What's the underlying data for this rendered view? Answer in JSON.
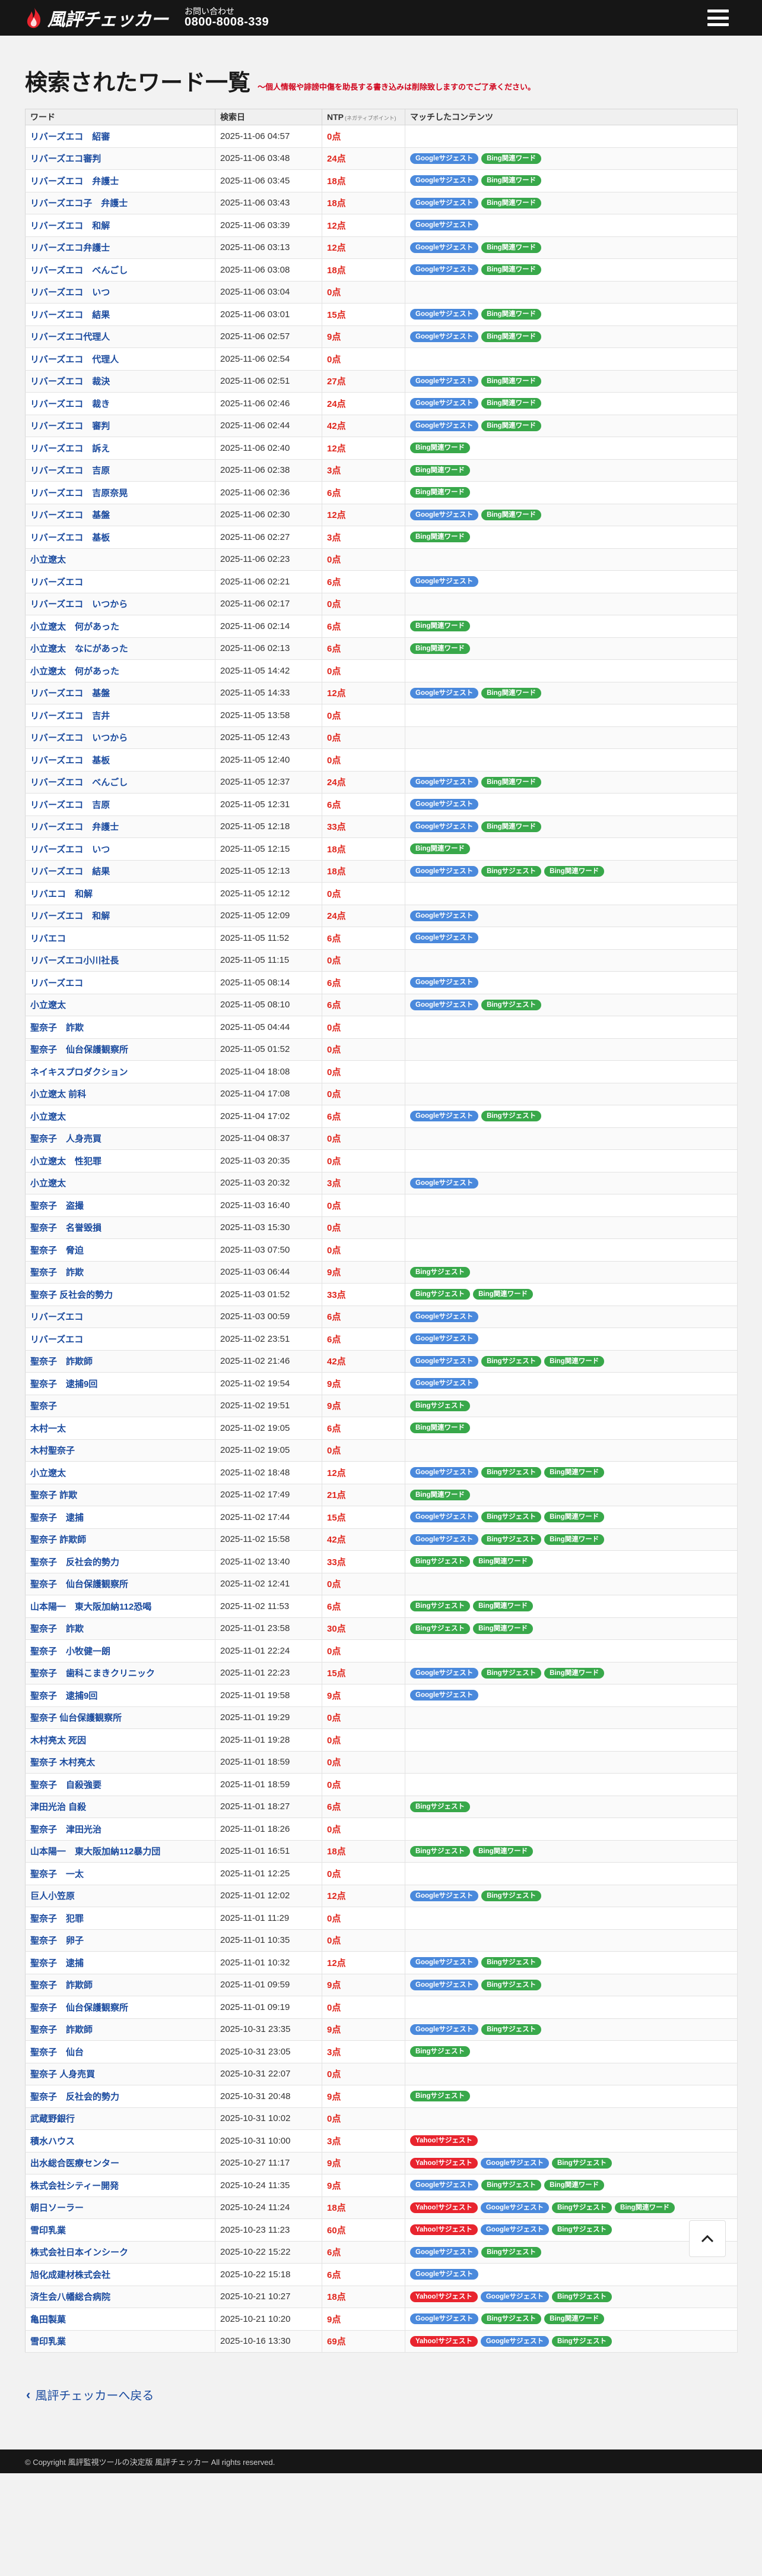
{
  "header": {
    "logo_text": "風評チェッカー",
    "contact_label": "お問い合わせ",
    "phone": "0800-8008-339"
  },
  "page": {
    "title": "検索されたワード一覧",
    "notice": "〜個人情報や誹謗中傷を助長する書き込みは削除致しますのでご了承ください。"
  },
  "table": {
    "headers": {
      "word": "ワード",
      "date": "検索日",
      "ntp": "NTP",
      "ntp_sub": "(ネガティブポイント)",
      "contents": "マッチしたコンテンツ"
    },
    "rows": [
      {
        "word": "リバーズエコ　紹審",
        "date": "2025-11-06 04:57",
        "points": "0点",
        "tags": []
      },
      {
        "word": "リバーズエコ審判",
        "date": "2025-11-06 03:48",
        "points": "24点",
        "tags": [
          "G",
          "BK"
        ]
      },
      {
        "word": "リバーズエコ　弁護士",
        "date": "2025-11-06 03:45",
        "points": "18点",
        "tags": [
          "G",
          "BK"
        ]
      },
      {
        "word": "リバーズエコ子　弁護士",
        "date": "2025-11-06 03:43",
        "points": "18点",
        "tags": [
          "G",
          "BK"
        ]
      },
      {
        "word": "リバーズエコ　和解",
        "date": "2025-11-06 03:39",
        "points": "12点",
        "tags": [
          "G"
        ]
      },
      {
        "word": "リバーズエコ弁護士",
        "date": "2025-11-06 03:13",
        "points": "12点",
        "tags": [
          "G",
          "BK"
        ]
      },
      {
        "word": "リバーズエコ　べんごし",
        "date": "2025-11-06 03:08",
        "points": "18点",
        "tags": [
          "G",
          "BK"
        ]
      },
      {
        "word": "リバーズエコ　いつ",
        "date": "2025-11-06 03:04",
        "points": "0点",
        "tags": []
      },
      {
        "word": "リバーズエコ　結果",
        "date": "2025-11-06 03:01",
        "points": "15点",
        "tags": [
          "G",
          "BK"
        ]
      },
      {
        "word": "リバーズエコ代理人",
        "date": "2025-11-06 02:57",
        "points": "9点",
        "tags": [
          "G",
          "BK"
        ]
      },
      {
        "word": "リバーズエコ　代理人",
        "date": "2025-11-06 02:54",
        "points": "0点",
        "tags": []
      },
      {
        "word": "リバーズエコ　裁決",
        "date": "2025-11-06 02:51",
        "points": "27点",
        "tags": [
          "G",
          "BK"
        ]
      },
      {
        "word": "リバーズエコ　裁き",
        "date": "2025-11-06 02:46",
        "points": "24点",
        "tags": [
          "G",
          "BK"
        ]
      },
      {
        "word": "リバーズエコ　審判",
        "date": "2025-11-06 02:44",
        "points": "42点",
        "tags": [
          "G",
          "BK"
        ]
      },
      {
        "word": "リバーズエコ　訴え",
        "date": "2025-11-06 02:40",
        "points": "12点",
        "tags": [
          "BK"
        ]
      },
      {
        "word": "リバーズエコ　吉原",
        "date": "2025-11-06 02:38",
        "points": "3点",
        "tags": [
          "BK"
        ]
      },
      {
        "word": "リバーズエコ　吉原奈晃",
        "date": "2025-11-06 02:36",
        "points": "6点",
        "tags": [
          "BK"
        ]
      },
      {
        "word": "リバーズエコ　基盤",
        "date": "2025-11-06 02:30",
        "points": "12点",
        "tags": [
          "G",
          "BK"
        ]
      },
      {
        "word": "リバーズエコ　基板",
        "date": "2025-11-06 02:27",
        "points": "3点",
        "tags": [
          "BK"
        ]
      },
      {
        "word": "小立遼太",
        "date": "2025-11-06 02:23",
        "points": "0点",
        "tags": []
      },
      {
        "word": "リバーズエコ",
        "date": "2025-11-06 02:21",
        "points": "6点",
        "tags": [
          "G"
        ]
      },
      {
        "word": "リバーズエコ　いつから",
        "date": "2025-11-06 02:17",
        "points": "0点",
        "tags": []
      },
      {
        "word": "小立遼太　何があった",
        "date": "2025-11-06 02:14",
        "points": "6点",
        "tags": [
          "BK"
        ]
      },
      {
        "word": "小立遼太　なにがあった",
        "date": "2025-11-06 02:13",
        "points": "6点",
        "tags": [
          "BK"
        ]
      },
      {
        "word": "小立遼太　何があった",
        "date": "2025-11-05 14:42",
        "points": "0点",
        "tags": []
      },
      {
        "word": "リバーズエコ　基盤",
        "date": "2025-11-05 14:33",
        "points": "12点",
        "tags": [
          "G",
          "BK"
        ]
      },
      {
        "word": "リバーズエコ　吉井",
        "date": "2025-11-05 13:58",
        "points": "0点",
        "tags": []
      },
      {
        "word": "リバーズエコ　いつから",
        "date": "2025-11-05 12:43",
        "points": "0点",
        "tags": []
      },
      {
        "word": "リバーズエコ　基板",
        "date": "2025-11-05 12:40",
        "points": "0点",
        "tags": []
      },
      {
        "word": "リバーズエコ　べんごし",
        "date": "2025-11-05 12:37",
        "points": "24点",
        "tags": [
          "G",
          "BK"
        ]
      },
      {
        "word": "リバーズエコ　吉原",
        "date": "2025-11-05 12:31",
        "points": "6点",
        "tags": [
          "G"
        ]
      },
      {
        "word": "リバーズエコ　弁護士",
        "date": "2025-11-05 12:18",
        "points": "33点",
        "tags": [
          "G",
          "BK"
        ]
      },
      {
        "word": "リバーズエコ　いつ",
        "date": "2025-11-05 12:15",
        "points": "18点",
        "tags": [
          "BK"
        ]
      },
      {
        "word": "リバーズエコ　結果",
        "date": "2025-11-05 12:13",
        "points": "18点",
        "tags": [
          "G",
          "BS",
          "BK"
        ]
      },
      {
        "word": "リバエコ　和解",
        "date": "2025-11-05 12:12",
        "points": "0点",
        "tags": []
      },
      {
        "word": "リバーズエコ　和解",
        "date": "2025-11-05 12:09",
        "points": "24点",
        "tags": [
          "G"
        ]
      },
      {
        "word": "リバエコ",
        "date": "2025-11-05 11:52",
        "points": "6点",
        "tags": [
          "G"
        ]
      },
      {
        "word": "リバーズエコ小川社長",
        "date": "2025-11-05 11:15",
        "points": "0点",
        "tags": []
      },
      {
        "word": "リバーズエコ",
        "date": "2025-11-05 08:14",
        "points": "6点",
        "tags": [
          "G"
        ]
      },
      {
        "word": "小立遼太",
        "date": "2025-11-05 08:10",
        "points": "6点",
        "tags": [
          "G",
          "BS"
        ]
      },
      {
        "word": "聖奈子　詐欺",
        "date": "2025-11-05 04:44",
        "points": "0点",
        "tags": []
      },
      {
        "word": "聖奈子　仙台保護観察所",
        "date": "2025-11-05 01:52",
        "points": "0点",
        "tags": []
      },
      {
        "word": "ネイキスプロダクション",
        "date": "2025-11-04 18:08",
        "points": "0点",
        "tags": []
      },
      {
        "word": "小立遼太 前科",
        "date": "2025-11-04 17:08",
        "points": "0点",
        "tags": []
      },
      {
        "word": "小立遼太",
        "date": "2025-11-04 17:02",
        "points": "6点",
        "tags": [
          "G",
          "BS"
        ]
      },
      {
        "word": "聖奈子　人身売買",
        "date": "2025-11-04 08:37",
        "points": "0点",
        "tags": []
      },
      {
        "word": "小立遼太　性犯罪",
        "date": "2025-11-03 20:35",
        "points": "0点",
        "tags": []
      },
      {
        "word": "小立遼太",
        "date": "2025-11-03 20:32",
        "points": "3点",
        "tags": [
          "G"
        ]
      },
      {
        "word": "聖奈子　盗撮",
        "date": "2025-11-03 16:40",
        "points": "0点",
        "tags": []
      },
      {
        "word": "聖奈子　名誉毀損",
        "date": "2025-11-03 15:30",
        "points": "0点",
        "tags": []
      },
      {
        "word": "聖奈子　脅迫",
        "date": "2025-11-03 07:50",
        "points": "0点",
        "tags": []
      },
      {
        "word": "聖奈子　詐欺",
        "date": "2025-11-03 06:44",
        "points": "9点",
        "tags": [
          "BS"
        ]
      },
      {
        "word": "聖奈子 反社会的勢力",
        "date": "2025-11-03 01:52",
        "points": "33点",
        "tags": [
          "BS",
          "BK"
        ]
      },
      {
        "word": "リバーズエコ",
        "date": "2025-11-03 00:59",
        "points": "6点",
        "tags": [
          "G"
        ]
      },
      {
        "word": "リバーズエコ",
        "date": "2025-11-02 23:51",
        "points": "6点",
        "tags": [
          "G"
        ]
      },
      {
        "word": "聖奈子　詐欺師",
        "date": "2025-11-02 21:46",
        "points": "42点",
        "tags": [
          "G",
          "BS",
          "BK"
        ]
      },
      {
        "word": "聖奈子　逮捕9回",
        "date": "2025-11-02 19:54",
        "points": "9点",
        "tags": [
          "G"
        ]
      },
      {
        "word": "聖奈子",
        "date": "2025-11-02 19:51",
        "points": "9点",
        "tags": [
          "BS"
        ]
      },
      {
        "word": "木村一太",
        "date": "2025-11-02 19:05",
        "points": "6点",
        "tags": [
          "BK"
        ]
      },
      {
        "word": "木村聖奈子",
        "date": "2025-11-02 19:05",
        "points": "0点",
        "tags": []
      },
      {
        "word": "小立遼太",
        "date": "2025-11-02 18:48",
        "points": "12点",
        "tags": [
          "G",
          "BS",
          "BK"
        ]
      },
      {
        "word": "聖奈子 詐欺",
        "date": "2025-11-02 17:49",
        "points": "21点",
        "tags": [
          "BK"
        ]
      },
      {
        "word": "聖奈子　逮捕",
        "date": "2025-11-02 17:44",
        "points": "15点",
        "tags": [
          "G",
          "BS",
          "BK"
        ]
      },
      {
        "word": "聖奈子 詐欺師",
        "date": "2025-11-02 15:58",
        "points": "42点",
        "tags": [
          "G",
          "BS",
          "BK"
        ]
      },
      {
        "word": "聖奈子　反社会的勢力",
        "date": "2025-11-02 13:40",
        "points": "33点",
        "tags": [
          "BS",
          "BK"
        ]
      },
      {
        "word": "聖奈子　仙台保護観察所",
        "date": "2025-11-02 12:41",
        "points": "0点",
        "tags": []
      },
      {
        "word": "山本陽一　東大阪加納112恐喝",
        "date": "2025-11-02 11:53",
        "points": "6点",
        "tags": [
          "BS",
          "BK"
        ]
      },
      {
        "word": "聖奈子　詐欺",
        "date": "2025-11-01 23:58",
        "points": "30点",
        "tags": [
          "BS",
          "BK"
        ]
      },
      {
        "word": "聖奈子　小牧健一朗",
        "date": "2025-11-01 22:24",
        "points": "0点",
        "tags": []
      },
      {
        "word": "聖奈子　歯科こまきクリニック",
        "date": "2025-11-01 22:23",
        "points": "15点",
        "tags": [
          "G",
          "BS",
          "BK"
        ]
      },
      {
        "word": "聖奈子　逮捕9回",
        "date": "2025-11-01 19:58",
        "points": "9点",
        "tags": [
          "G"
        ]
      },
      {
        "word": "聖奈子 仙台保護観察所",
        "date": "2025-11-01 19:29",
        "points": "0点",
        "tags": []
      },
      {
        "word": "木村亮太 死因",
        "date": "2025-11-01 19:28",
        "points": "0点",
        "tags": []
      },
      {
        "word": "聖奈子 木村亮太",
        "date": "2025-11-01 18:59",
        "points": "0点",
        "tags": []
      },
      {
        "word": "聖奈子　自殺強要",
        "date": "2025-11-01 18:59",
        "points": "0点",
        "tags": []
      },
      {
        "word": "津田光治 自殺",
        "date": "2025-11-01 18:27",
        "points": "6点",
        "tags": [
          "BS"
        ]
      },
      {
        "word": "聖奈子　津田光治",
        "date": "2025-11-01 18:26",
        "points": "0点",
        "tags": []
      },
      {
        "word": "山本陽一　東大阪加納112暴力団",
        "date": "2025-11-01 16:51",
        "points": "18点",
        "tags": [
          "BS",
          "BK"
        ]
      },
      {
        "word": "聖奈子　一太",
        "date": "2025-11-01 12:25",
        "points": "0点",
        "tags": []
      },
      {
        "word": "巨人小笠原",
        "date": "2025-11-01 12:02",
        "points": "12点",
        "tags": [
          "G",
          "BS"
        ]
      },
      {
        "word": "聖奈子　犯罪",
        "date": "2025-11-01 11:29",
        "points": "0点",
        "tags": []
      },
      {
        "word": "聖奈子　卵子",
        "date": "2025-11-01 10:35",
        "points": "0点",
        "tags": []
      },
      {
        "word": "聖奈子　逮捕",
        "date": "2025-11-01 10:32",
        "points": "12点",
        "tags": [
          "G",
          "BS"
        ]
      },
      {
        "word": "聖奈子　詐欺師",
        "date": "2025-11-01 09:59",
        "points": "9点",
        "tags": [
          "G",
          "BS"
        ]
      },
      {
        "word": "聖奈子　仙台保護観察所",
        "date": "2025-11-01 09:19",
        "points": "0点",
        "tags": []
      },
      {
        "word": "聖奈子　詐欺師",
        "date": "2025-10-31 23:35",
        "points": "9点",
        "tags": [
          "G",
          "BS"
        ]
      },
      {
        "word": "聖奈子　仙台",
        "date": "2025-10-31 23:05",
        "points": "3点",
        "tags": [
          "BS"
        ]
      },
      {
        "word": "聖奈子 人身売買",
        "date": "2025-10-31 22:07",
        "points": "0点",
        "tags": []
      },
      {
        "word": "聖奈子　反社会的勢力",
        "date": "2025-10-31 20:48",
        "points": "9点",
        "tags": [
          "BS"
        ]
      },
      {
        "word": "武蔵野銀行",
        "date": "2025-10-31 10:02",
        "points": "0点",
        "tags": []
      },
      {
        "word": "積水ハウス",
        "date": "2025-10-31 10:00",
        "points": "3点",
        "tags": [
          "Y"
        ]
      },
      {
        "word": "出水総合医療センター",
        "date": "2025-10-27 11:17",
        "points": "9点",
        "tags": [
          "Y",
          "G",
          "BS"
        ]
      },
      {
        "word": "株式会社シティー開発",
        "date": "2025-10-24 11:35",
        "points": "9点",
        "tags": [
          "G",
          "BS",
          "BK"
        ]
      },
      {
        "word": "朝日ソーラー",
        "date": "2025-10-24 11:24",
        "points": "18点",
        "tags": [
          "Y",
          "G",
          "BS",
          "BK"
        ]
      },
      {
        "word": "雪印乳業",
        "date": "2025-10-23 11:23",
        "points": "60点",
        "tags": [
          "Y",
          "G",
          "BS"
        ]
      },
      {
        "word": "株式会社日本インシーク",
        "date": "2025-10-22 15:22",
        "points": "6点",
        "tags": [
          "G",
          "BS"
        ]
      },
      {
        "word": "旭化成建材株式会社",
        "date": "2025-10-22 15:18",
        "points": "6点",
        "tags": [
          "G"
        ]
      },
      {
        "word": "済生会八幡総合病院",
        "date": "2025-10-21 10:27",
        "points": "18点",
        "tags": [
          "Y",
          "G",
          "BS"
        ]
      },
      {
        "word": "亀田製菓",
        "date": "2025-10-21 10:20",
        "points": "9点",
        "tags": [
          "G",
          "BS",
          "BK"
        ]
      },
      {
        "word": "雪印乳業",
        "date": "2025-10-16 13:30",
        "points": "69点",
        "tags": [
          "Y",
          "G",
          "BS"
        ]
      }
    ]
  },
  "tag_labels": {
    "G": "Googleサジェスト",
    "BK": "Bing関連ワード",
    "BS": "Bingサジェスト",
    "Y": "Yahoo!サジェスト"
  },
  "colors": {
    "header_bg": "#161616",
    "google": "#4a89dc",
    "bing": "#38a84a",
    "yahoo": "#e8242e",
    "points": "#e0241b",
    "link": "#1a4a9e"
  },
  "back_link": "風評チェッカーへ戻る",
  "footer": "© Copyright 風評監視ツールの決定版 風評チェッカー All rights reserved."
}
